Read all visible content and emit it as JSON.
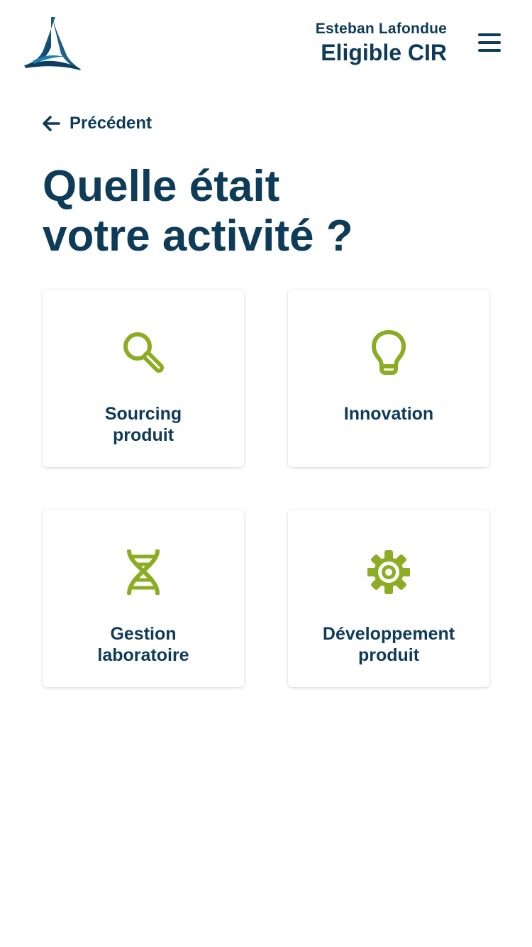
{
  "header": {
    "user_name": "Esteban Lafondue",
    "user_status": "Eligible CIR",
    "menu_icon": "hamburger-menu-icon"
  },
  "navigation": {
    "back_label": "Précédent",
    "back_icon": "arrow-left-icon"
  },
  "page": {
    "title_line1": "Quelle était",
    "title_line2": "votre activité ?"
  },
  "activities": [
    {
      "line1": "Sourcing",
      "line2": "produit",
      "icon": "search-icon"
    },
    {
      "line1": "Innovation",
      "line2": "",
      "icon": "lightbulb-icon"
    },
    {
      "line1": "Gestion",
      "line2": "laboratoire",
      "icon": "dna-icon"
    },
    {
      "line1": "Développement",
      "line2": "produit",
      "icon": "gear-icon"
    }
  ],
  "colors": {
    "primary": "#0e3b58",
    "accent": "#8cad23",
    "background": "#ffffff"
  }
}
